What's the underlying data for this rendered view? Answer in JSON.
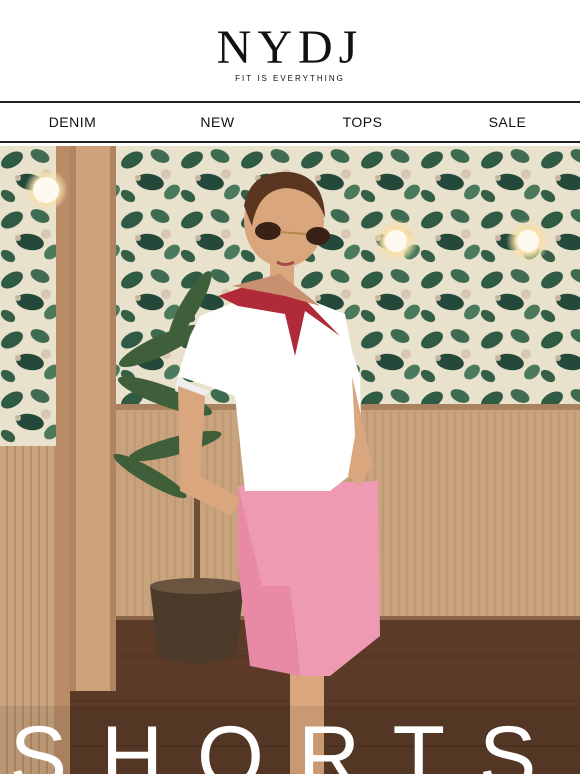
{
  "brand": {
    "logo": "NYDJ",
    "tagline": "FIT IS EVERYTHING"
  },
  "nav": {
    "items": [
      "DENIM",
      "NEW",
      "TOPS",
      "SALE"
    ]
  },
  "hero": {
    "headline": "SHORTS"
  },
  "colors": {
    "wallpaper_green": "#2f5a43",
    "wood_panel": "#c7a07a",
    "floor": "#5a3a26",
    "shorts_pink": "#ee9ab3",
    "scarf_red": "#b02a3a"
  }
}
